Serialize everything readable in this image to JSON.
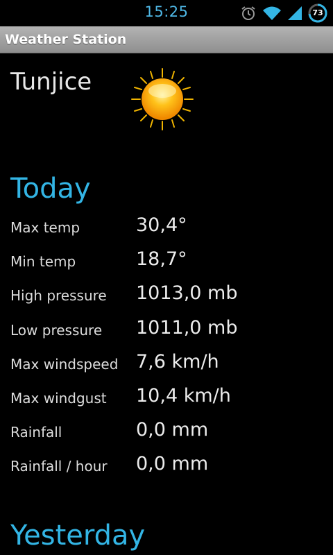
{
  "status_bar": {
    "time": "15:25",
    "battery_level": "73",
    "icons": [
      "alarm-icon",
      "wifi-icon",
      "signal-icon",
      "battery-icon"
    ],
    "accent_color": "#4fb8e6"
  },
  "app": {
    "title": "Weather Station"
  },
  "station": {
    "name": "Tunjice",
    "condition_icon": "sun-icon"
  },
  "today": {
    "heading": "Today",
    "rows": [
      {
        "label": "Max temp",
        "value": "30,4°"
      },
      {
        "label": "Min temp",
        "value": "18,7°"
      },
      {
        "label": "High pressure",
        "value": "1013,0 mb"
      },
      {
        "label": "Low pressure",
        "value": "1011,0 mb"
      },
      {
        "label": "Max windspeed",
        "value": "7,6 km/h"
      },
      {
        "label": "Max windgust",
        "value": "10,4 km/h"
      },
      {
        "label": "Rainfall",
        "value": "0,0 mm"
      },
      {
        "label": "Rainfall / hour",
        "value": "0,0 mm"
      }
    ]
  },
  "yesterday": {
    "heading": "Yesterday"
  },
  "colors": {
    "heading": "#33b5e5",
    "background": "#000000"
  }
}
